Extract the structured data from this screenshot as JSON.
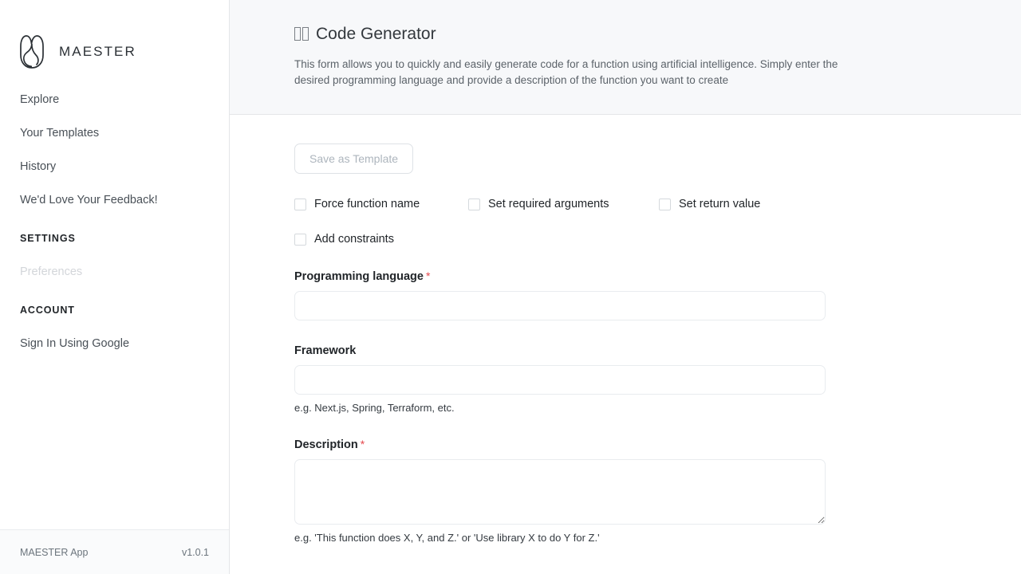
{
  "sidebar": {
    "brand": {
      "name": "MAESTER",
      "logo_icon": "maester-logo-icon"
    },
    "nav_items": [
      {
        "label": "Explore"
      },
      {
        "label": "Your Templates"
      },
      {
        "label": "History"
      },
      {
        "label": "We'd Love Your Feedback!"
      }
    ],
    "sections": [
      {
        "title": "SETTINGS",
        "items": [
          {
            "label": "Preferences",
            "disabled": true
          }
        ]
      },
      {
        "title": "ACCOUNT",
        "items": [
          {
            "label": "Sign In Using Google",
            "disabled": false
          }
        ]
      }
    ],
    "footer": {
      "app_name": "MAESTER App",
      "version": "v1.0.1"
    }
  },
  "header": {
    "title": "Code Generator",
    "title_icon": "missing-glyph-emoji",
    "description": "This form allows you to quickly and easily generate code for a function using artificial intelligence. Simply enter the desired programming language and provide a description of the function you want to create"
  },
  "form": {
    "save_template_label": "Save as Template",
    "checkboxes": [
      {
        "label": "Force function name",
        "checked": false
      },
      {
        "label": "Set required arguments",
        "checked": false
      },
      {
        "label": "Set return value",
        "checked": false
      },
      {
        "label": "Add constraints",
        "checked": false
      }
    ],
    "fields": {
      "programming_language": {
        "label": "Programming language",
        "required_marker": "*",
        "value": "",
        "placeholder": ""
      },
      "framework": {
        "label": "Framework",
        "value": "",
        "placeholder": "",
        "help": "e.g. Next.js, Spring, Terraform, etc."
      },
      "description": {
        "label": "Description",
        "required_marker": "*",
        "value": "",
        "placeholder": "",
        "help": "e.g. 'This function does X, Y, and Z.' or 'Use library X to do Y for Z.'"
      }
    }
  },
  "colors": {
    "accent_required": "#e5484d",
    "header_bg": "#f7f8fa",
    "border": "#e4e6e8",
    "text_primary": "#212529",
    "text_muted": "#6c757d",
    "text_disabled": "#d3d6da"
  }
}
